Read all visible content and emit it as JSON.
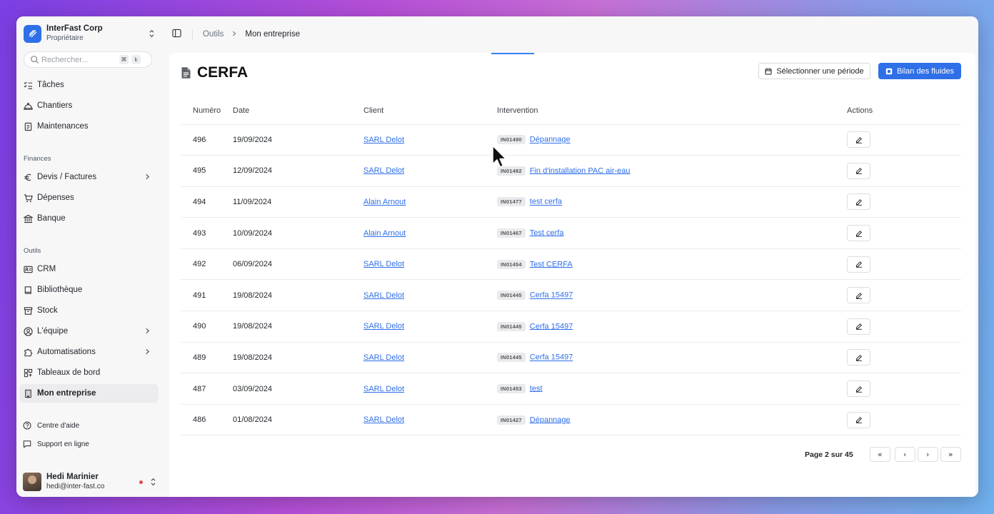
{
  "org": {
    "name": "InterFast Corp",
    "role": "Propriétaire"
  },
  "search": {
    "placeholder": "Rechercher...",
    "key1": "⌘",
    "key2": "k"
  },
  "nav": {
    "taches": "Tâches",
    "chantiers": "Chantiers",
    "maintenances": "Maintenances",
    "finances_title": "Finances",
    "devis": "Devis / Factures",
    "depenses": "Dépenses",
    "banque": "Banque",
    "outils_title": "Outils",
    "crm": "CRM",
    "bibliotheque": "Bibliothèque",
    "stock": "Stock",
    "equipe": "L'équipe",
    "automatisations": "Automatisations",
    "tableaux": "Tableaux de bord",
    "entreprise": "Mon entreprise",
    "aide": "Centre d'aide",
    "support": "Support en ligne"
  },
  "user": {
    "name": "Hedi Marinier",
    "email": "hedi@inter-fast.co"
  },
  "breadcrumb": {
    "parent": "Outils",
    "current": "Mon entreprise"
  },
  "page": {
    "title": "CERFA",
    "period_button": "Sélectionner une période",
    "fluids_button": "Bilan des fluides"
  },
  "table": {
    "headers": {
      "numero": "Numéro",
      "date": "Date",
      "client": "Client",
      "intervention": "Intervention",
      "actions": "Actions"
    },
    "rows": [
      {
        "num": "496",
        "date": "19/09/2024",
        "client": "SARL Delot",
        "code": "IN01490",
        "intervention": "Dépannage"
      },
      {
        "num": "495",
        "date": "12/09/2024",
        "client": "SARL Delot",
        "code": "IN01482",
        "intervention": "Fin d'installation PAC air-eau"
      },
      {
        "num": "494",
        "date": "11/09/2024",
        "client": "Alain Arnout",
        "code": "IN01477",
        "intervention": "test cerfa"
      },
      {
        "num": "493",
        "date": "10/09/2024",
        "client": "Alain Arnout",
        "code": "IN01467",
        "intervention": "Test cerfa"
      },
      {
        "num": "492",
        "date": "06/09/2024",
        "client": "SARL Delot",
        "code": "IN01454",
        "intervention": "Test CERFA"
      },
      {
        "num": "491",
        "date": "19/08/2024",
        "client": "SARL Delot",
        "code": "IN01445",
        "intervention": "Cerfa 15497"
      },
      {
        "num": "490",
        "date": "19/08/2024",
        "client": "SARL Delot",
        "code": "IN01445",
        "intervention": "Cerfa 15497"
      },
      {
        "num": "489",
        "date": "19/08/2024",
        "client": "SARL Delot",
        "code": "IN01445",
        "intervention": "Cerfa 15497"
      },
      {
        "num": "487",
        "date": "03/09/2024",
        "client": "SARL Delot",
        "code": "IN01453",
        "intervention": "test"
      },
      {
        "num": "486",
        "date": "01/08/2024",
        "client": "SARL Delot",
        "code": "IN01427",
        "intervention": "Dépannage"
      }
    ]
  },
  "pagination": {
    "label": "Page 2 sur 45",
    "first": "«",
    "prev": "‹",
    "next": "›",
    "last": "»"
  },
  "colors": {
    "accent": "#2f6fe8",
    "link": "#2f6fe8",
    "status_dot": "#e04848"
  }
}
